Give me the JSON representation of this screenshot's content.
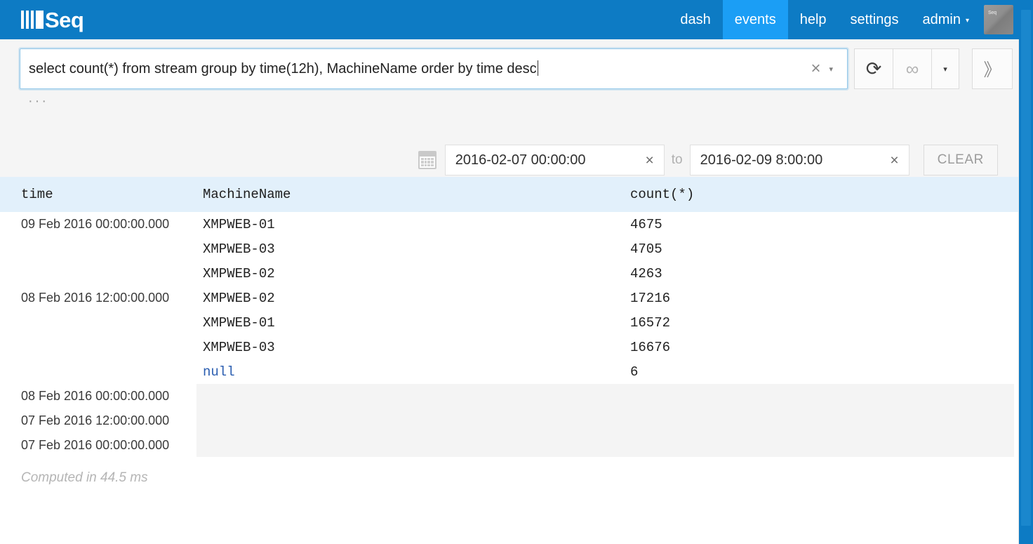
{
  "brand": {
    "name": "Seq",
    "logo_icon": "seq-bars-logo"
  },
  "nav": {
    "items": [
      {
        "label": "dash",
        "active": false
      },
      {
        "label": "events",
        "active": true
      },
      {
        "label": "help",
        "active": false
      },
      {
        "label": "settings",
        "active": false
      }
    ],
    "user": {
      "label": "admin",
      "caret": "▾",
      "avatar_icon": "user-avatar",
      "avatar_logo": "Seq"
    }
  },
  "query": {
    "value": "select count(*) from stream group by time(12h), MachineName order by time desc",
    "placeholder": "",
    "clear_icon": "×",
    "history_caret": "▾",
    "ellipsis": "···"
  },
  "toolbar": {
    "refresh_icon": "⟳",
    "infinity_icon": "∞",
    "interval_caret": "▾",
    "expand_icon": "》"
  },
  "range": {
    "calendar_icon": "calendar-icon",
    "from": "2016-02-07 00:00:00",
    "to": "2016-02-09 8:00:00",
    "to_label": "to",
    "clear_icon": "×",
    "clear_button": "CLEAR"
  },
  "table": {
    "columns": [
      "time",
      "MachineName",
      "count(*)"
    ],
    "rows": [
      {
        "time": "09 Feb 2016 00:00:00.000",
        "machine": "XMPWEB-01",
        "count": "4675",
        "null": false,
        "empty": false
      },
      {
        "time": "",
        "machine": "XMPWEB-03",
        "count": "4705",
        "null": false,
        "empty": false
      },
      {
        "time": "",
        "machine": "XMPWEB-02",
        "count": "4263",
        "null": false,
        "empty": false
      },
      {
        "time": "08 Feb 2016 12:00:00.000",
        "machine": "XMPWEB-02",
        "count": "17216",
        "null": false,
        "empty": false
      },
      {
        "time": "",
        "machine": "XMPWEB-01",
        "count": "16572",
        "null": false,
        "empty": false
      },
      {
        "time": "",
        "machine": "XMPWEB-03",
        "count": "16676",
        "null": false,
        "empty": false
      },
      {
        "time": "",
        "machine": "null",
        "count": "6",
        "null": true,
        "empty": false
      },
      {
        "time": "08 Feb 2016 00:00:00.000",
        "machine": "",
        "count": "",
        "null": false,
        "empty": true
      },
      {
        "time": "07 Feb 2016 12:00:00.000",
        "machine": "",
        "count": "",
        "null": false,
        "empty": true
      },
      {
        "time": "07 Feb 2016 00:00:00.000",
        "machine": "",
        "count": "",
        "null": false,
        "empty": true
      }
    ],
    "footer": "Computed in 44.5 ms"
  },
  "colors": {
    "brand_blue": "#0d7bc4",
    "active_tab_blue": "#1b9ef5",
    "header_row_blue": "#e2f0fb",
    "toolbar_gray": "#f5f5f5",
    "null_value_blue": "#2a5db0"
  }
}
